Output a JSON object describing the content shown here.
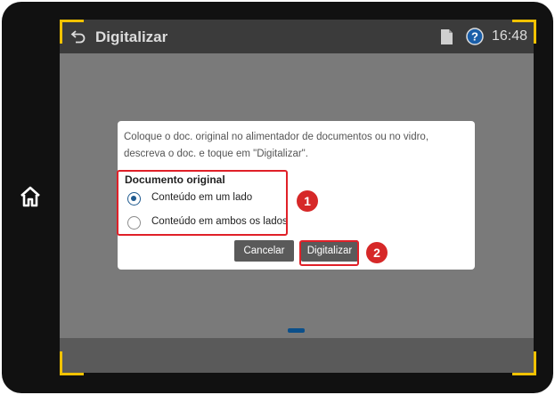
{
  "header": {
    "title": "Digitalizar",
    "time": "16:48",
    "icons": {
      "back": "back-arrow-icon",
      "document": "document-icon",
      "help": "help-icon"
    }
  },
  "device": {
    "home_icon": "home-icon"
  },
  "dialog": {
    "instructions": "Coloque o doc. original no alimentador de documentos ou no vidro, descreva o doc. e toque em \"Digitalizar\".",
    "group_title": "Documento original",
    "options": [
      {
        "label": "Conteúdo em um lado",
        "selected": true
      },
      {
        "label": "Conteúdo em ambos os lados",
        "selected": false
      }
    ],
    "cancel_label": "Cancelar",
    "scan_label": "Digitalizar"
  },
  "annotations": {
    "badge_1": "1",
    "badge_2": "2"
  },
  "colors": {
    "accent": "#1f5a8f",
    "highlight": "#e02028",
    "corner": "#f2c200"
  }
}
